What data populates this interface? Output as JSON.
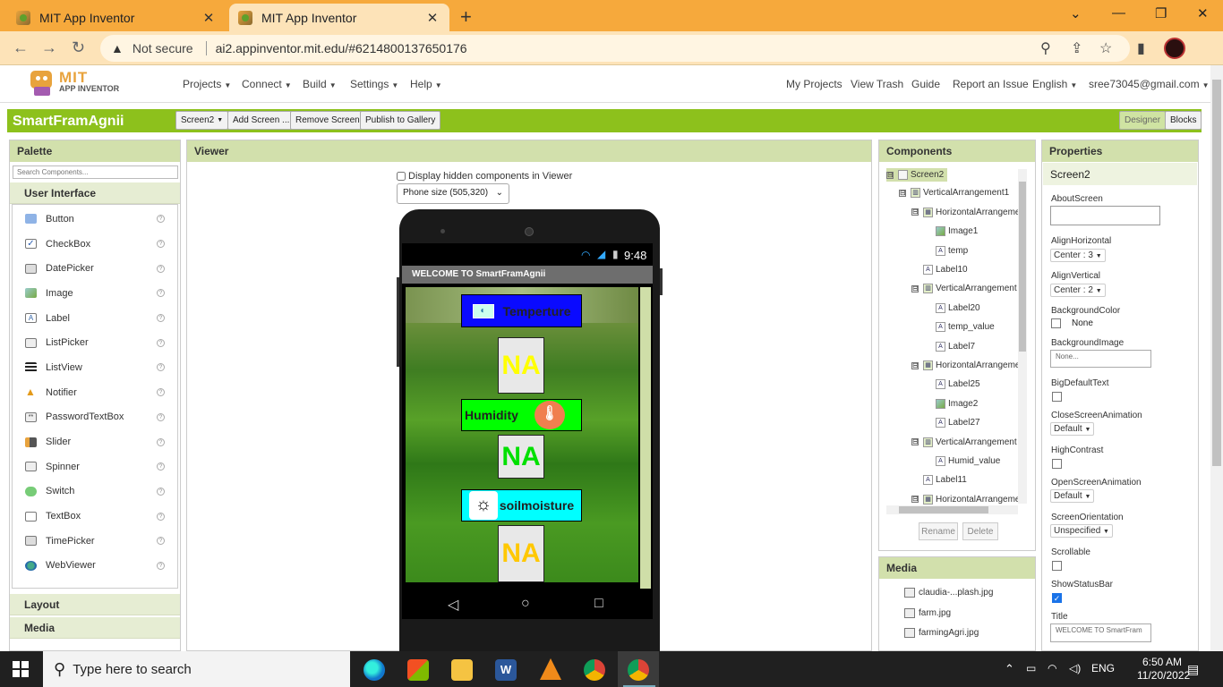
{
  "browser": {
    "tabs": [
      {
        "title": "MIT App Inventor",
        "active": false
      },
      {
        "title": "MIT App Inventor",
        "active": true
      }
    ],
    "new_tab": "+",
    "security_label": "Not secure",
    "url": "ai2.appinventor.mit.edu/#6214800137650176"
  },
  "app": {
    "logo_line1": "MIT",
    "logo_line2": "APP INVENTOR",
    "left_menu": [
      "Projects",
      "Connect",
      "Build",
      "Settings",
      "Help"
    ],
    "right_menu": [
      "My Projects",
      "View Trash",
      "Guide",
      "Report an Issue",
      "English",
      "sree73045@gmail.com"
    ],
    "project_name": "SmartFramAgnii",
    "toolbar": {
      "screen": "Screen2",
      "add_screen": "Add Screen ...",
      "remove_screen": "Remove Screen",
      "publish": "Publish to Gallery",
      "designer": "Designer",
      "blocks": "Blocks"
    }
  },
  "palette": {
    "header": "Palette",
    "search_placeholder": "Search Components...",
    "section": "User Interface",
    "items": [
      "Button",
      "CheckBox",
      "DatePicker",
      "Image",
      "Label",
      "ListPicker",
      "ListView",
      "Notifier",
      "PasswordTextBox",
      "Slider",
      "Spinner",
      "Switch",
      "TextBox",
      "TimePicker",
      "WebViewer"
    ],
    "help_glyph": "?",
    "more_sections": [
      "Layout",
      "Media"
    ]
  },
  "viewer": {
    "header": "Viewer",
    "hidden_checkbox": "Display hidden components in Viewer",
    "phone_size": "Phone size (505,320)",
    "time": "9:48",
    "screen_title": "WELCOME TO SmartFramAgnii",
    "temperature_label": "Temperture",
    "humidity_label": "Humidity",
    "soil_label": "soilmoisture",
    "temp_value": "NA",
    "humid_value": "NA",
    "soil_value": "NA",
    "colors": {
      "temp_bg": "#0a0aff",
      "humid_bg": "#00ff00",
      "soil_bg": "#00ffff",
      "temp_value_color": "#ffff00",
      "humid_value_color": "#00e000",
      "soil_value_color": "#ffc800"
    }
  },
  "components": {
    "header": "Components",
    "tree": [
      {
        "label": "Screen2",
        "level": 0,
        "toggle": "⊟",
        "icon": "screen"
      },
      {
        "label": "VerticalArrangement1",
        "level": 1,
        "toggle": "⊟",
        "icon": "arr"
      },
      {
        "label": "HorizontalArrangement",
        "level": 2,
        "toggle": "⊟",
        "icon": "harr"
      },
      {
        "label": "Image1",
        "level": 3,
        "toggle": "",
        "icon": "img"
      },
      {
        "label": "temp",
        "level": 3,
        "toggle": "",
        "icon": "A"
      },
      {
        "label": "Label10",
        "level": 2,
        "toggle": "",
        "icon": "A"
      },
      {
        "label": "VerticalArrangement",
        "level": 2,
        "toggle": "⊟",
        "icon": "arr"
      },
      {
        "label": "Label20",
        "level": 3,
        "toggle": "",
        "icon": "A"
      },
      {
        "label": "temp_value",
        "level": 3,
        "toggle": "",
        "icon": "A"
      },
      {
        "label": "Label7",
        "level": 3,
        "toggle": "",
        "icon": "A"
      },
      {
        "label": "HorizontalArrangement",
        "level": 2,
        "toggle": "⊟",
        "icon": "harr"
      },
      {
        "label": "Label25",
        "level": 3,
        "toggle": "",
        "icon": "A"
      },
      {
        "label": "Image2",
        "level": 3,
        "toggle": "",
        "icon": "img"
      },
      {
        "label": "Label27",
        "level": 3,
        "toggle": "",
        "icon": "A"
      },
      {
        "label": "VerticalArrangement",
        "level": 2,
        "toggle": "⊟",
        "icon": "arr"
      },
      {
        "label": "Humid_value",
        "level": 3,
        "toggle": "",
        "icon": "A"
      },
      {
        "label": "Label11",
        "level": 2,
        "toggle": "",
        "icon": "A"
      },
      {
        "label": "HorizontalArrangement",
        "level": 2,
        "toggle": "⊟",
        "icon": "harr"
      }
    ],
    "rename": "Rename",
    "delete": "Delete"
  },
  "media": {
    "header": "Media",
    "files": [
      "claudia-...plash.jpg",
      "farm.jpg",
      "farmingAgri.jpg"
    ]
  },
  "properties": {
    "header": "Properties",
    "component": "Screen2",
    "about_screen": "AboutScreen",
    "align_horizontal": "AlignHorizontal",
    "align_horizontal_value": "Center : 3",
    "align_vertical": "AlignVertical",
    "align_vertical_value": "Center : 2",
    "background_color": "BackgroundColor",
    "background_color_value": "None",
    "background_image": "BackgroundImage",
    "background_image_value": "None...",
    "big_default_text": "BigDefaultText",
    "close_screen_animation": "CloseScreenAnimation",
    "close_screen_animation_value": "Default",
    "high_contrast": "HighContrast",
    "open_screen_animation": "OpenScreenAnimation",
    "open_screen_animation_value": "Default",
    "screen_orientation": "ScreenOrientation",
    "screen_orientation_value": "Unspecified",
    "scrollable": "Scrollable",
    "show_status_bar": "ShowStatusBar",
    "title": "Title",
    "title_value": "WELCOME TO SmartFram"
  },
  "taskbar": {
    "search_placeholder": "Type here to search",
    "language": "ENG",
    "time": "6:50 AM",
    "date": "11/20/2022"
  }
}
